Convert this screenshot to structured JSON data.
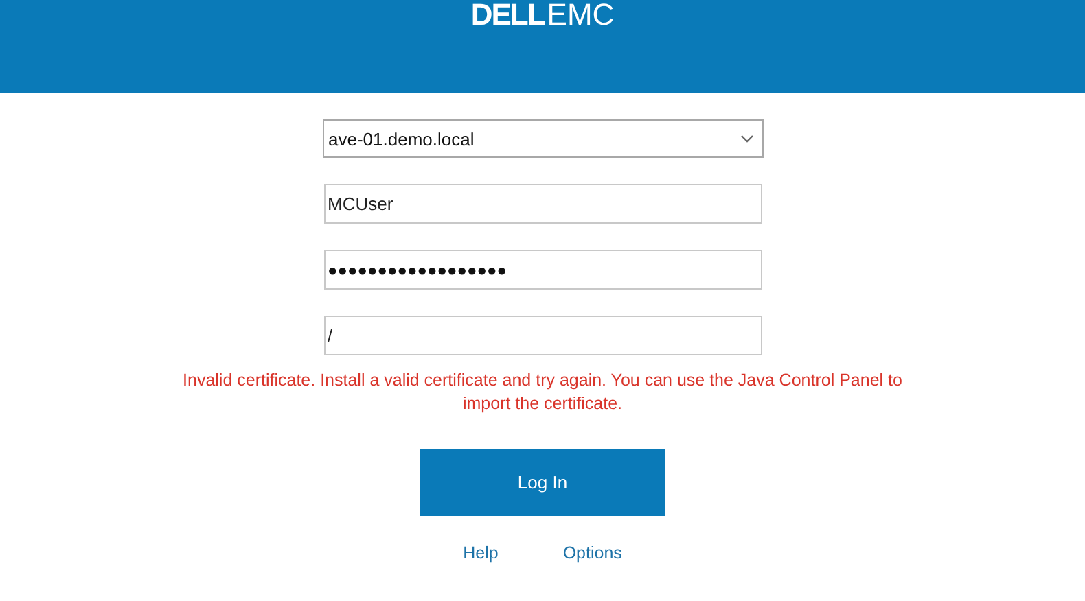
{
  "header": {
    "logo": {
      "brand": "DELL",
      "product": "EMC"
    }
  },
  "form": {
    "server": {
      "value": "ave-01.demo.local"
    },
    "fields": [
      {
        "kind": "text",
        "value": "MCUser"
      },
      {
        "kind": "password",
        "value": "●●●●●●●●●●●●●●●●●●"
      },
      {
        "kind": "text",
        "value": "/"
      }
    ],
    "error": "Invalid certificate. Install a valid certificate and try again. You can use the Java Control Panel to import the certificate.",
    "login_button": "Log In",
    "links": [
      "Help",
      "Options"
    ]
  }
}
